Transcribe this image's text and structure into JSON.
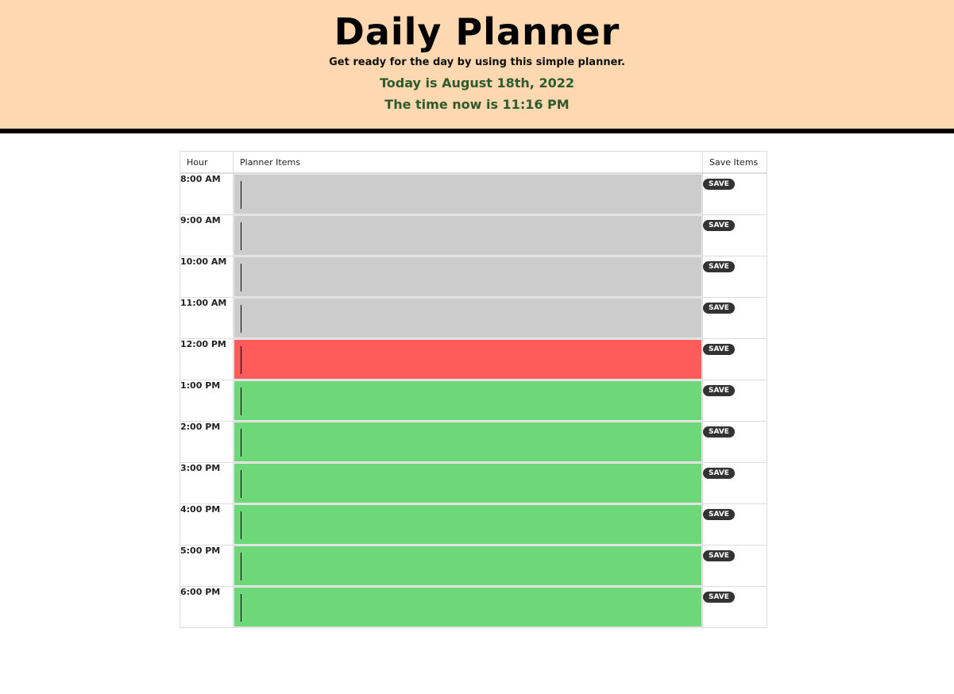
{
  "header": {
    "title": "Daily Planner",
    "subtitle": "Get ready for the day by using this simple planner.",
    "date_text": "Today is August 18th, 2022",
    "time_text": "The time now is 11:16 PM"
  },
  "table": {
    "headers": {
      "hour": "Hour",
      "items": "Planner Items",
      "save": "Save Items"
    },
    "save_label": "SAVE",
    "rows": [
      {
        "hour": "8:00 AM",
        "state": "past",
        "value": ""
      },
      {
        "hour": "9:00 AM",
        "state": "past",
        "value": ""
      },
      {
        "hour": "10:00 AM",
        "state": "past",
        "value": ""
      },
      {
        "hour": "11:00 AM",
        "state": "past",
        "value": ""
      },
      {
        "hour": "12:00 PM",
        "state": "present",
        "value": ""
      },
      {
        "hour": "1:00 PM",
        "state": "future",
        "value": ""
      },
      {
        "hour": "2:00 PM",
        "state": "future",
        "value": ""
      },
      {
        "hour": "3:00 PM",
        "state": "future",
        "value": ""
      },
      {
        "hour": "4:00 PM",
        "state": "future",
        "value": ""
      },
      {
        "hour": "5:00 PM",
        "state": "future",
        "value": ""
      },
      {
        "hour": "6:00 PM",
        "state": "future",
        "value": ""
      }
    ]
  },
  "colors": {
    "header_bg": "#fed8b1",
    "past": "#cccccc",
    "present": "#ff5b5b",
    "future": "#6dd877",
    "date_text": "#2e5a2e",
    "save_button": "#333333"
  }
}
